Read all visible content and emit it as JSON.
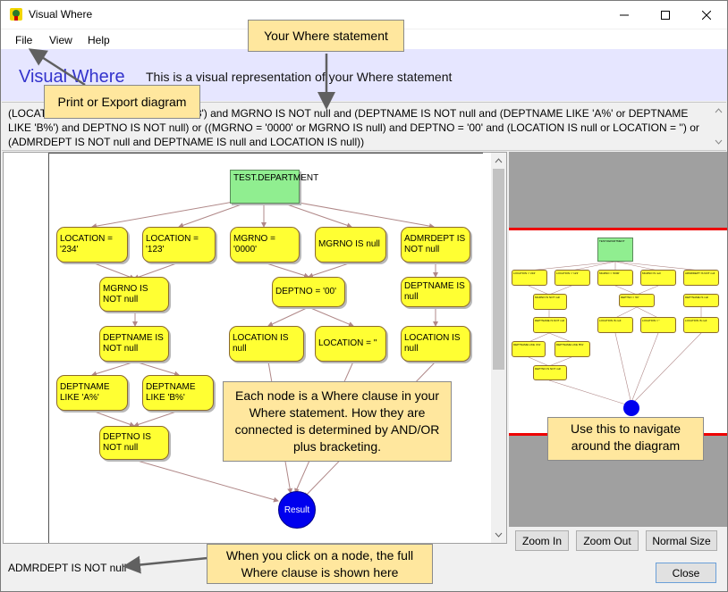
{
  "window": {
    "title": "Visual Where"
  },
  "menu": {
    "items": [
      "File",
      "View",
      "Help"
    ]
  },
  "banner": {
    "title": "Visual Where",
    "subtitle": "This is a visual representation of your Where statement"
  },
  "where_statement": "(LOCATION = '234' or LOCATION = '123') and MGRNO IS NOT null and (DEPTNAME IS NOT null and (DEPTNAME LIKE 'A%' or DEPTNAME LIKE 'B%') and DEPTNO IS NOT null) or ((MGRNO = '0000' or MGRNO IS null) and DEPTNO = '00' and (LOCATION IS null or LOCATION = '') or (ADMRDEPT IS NOT null and DEPTNAME IS null and LOCATION IS null))",
  "diagram": {
    "root": "TEST.DEPARTMENT",
    "nodes": {
      "loc234": "LOCATION = '234'",
      "loc123": "LOCATION = '123'",
      "mgrno0000": "MGRNO = '0000'",
      "mgrnonull": "MGRNO IS null",
      "admrdept": "ADMRDEPT IS NOT null",
      "mgrnonotnull": "MGRNO IS NOT null",
      "deptno00": "DEPTNO = '00'",
      "deptnamenull": "DEPTNAME IS null",
      "deptnamenotnull": "DEPTNAME IS NOT null",
      "locnull1": "LOCATION IS null",
      "locempty": "LOCATION = ''",
      "locnull2": "LOCATION IS null",
      "likeA": "DEPTNAME LIKE 'A%'",
      "likeB": "DEPTNAME LIKE 'B%'",
      "deptnonotnull": "DEPTNO IS NOT null"
    },
    "result": "Result"
  },
  "buttons": {
    "zoom_in": "Zoom In",
    "zoom_out": "Zoom Out",
    "normal_size": "Normal Size",
    "close": "Close"
  },
  "status": {
    "selected_clause": "ADMRDEPT IS NOT null"
  },
  "callouts": {
    "where": "Your Where statement",
    "print": "Print or Export diagram",
    "node": "Each node is a Where clause in your Where statement. How they are connected is determined by AND/OR plus bracketing.",
    "navigate": "Use this to navigate around the diagram",
    "click": "When you click on a node, the full Where clause is shown here"
  },
  "colors": {
    "accent": "#3333cc",
    "banner_bg": "#e6e6ff",
    "node": "#ffff33",
    "root": "#90ee90",
    "result": "#0000ee",
    "callout": "#ffe79e",
    "viewport": "#ee0000"
  }
}
